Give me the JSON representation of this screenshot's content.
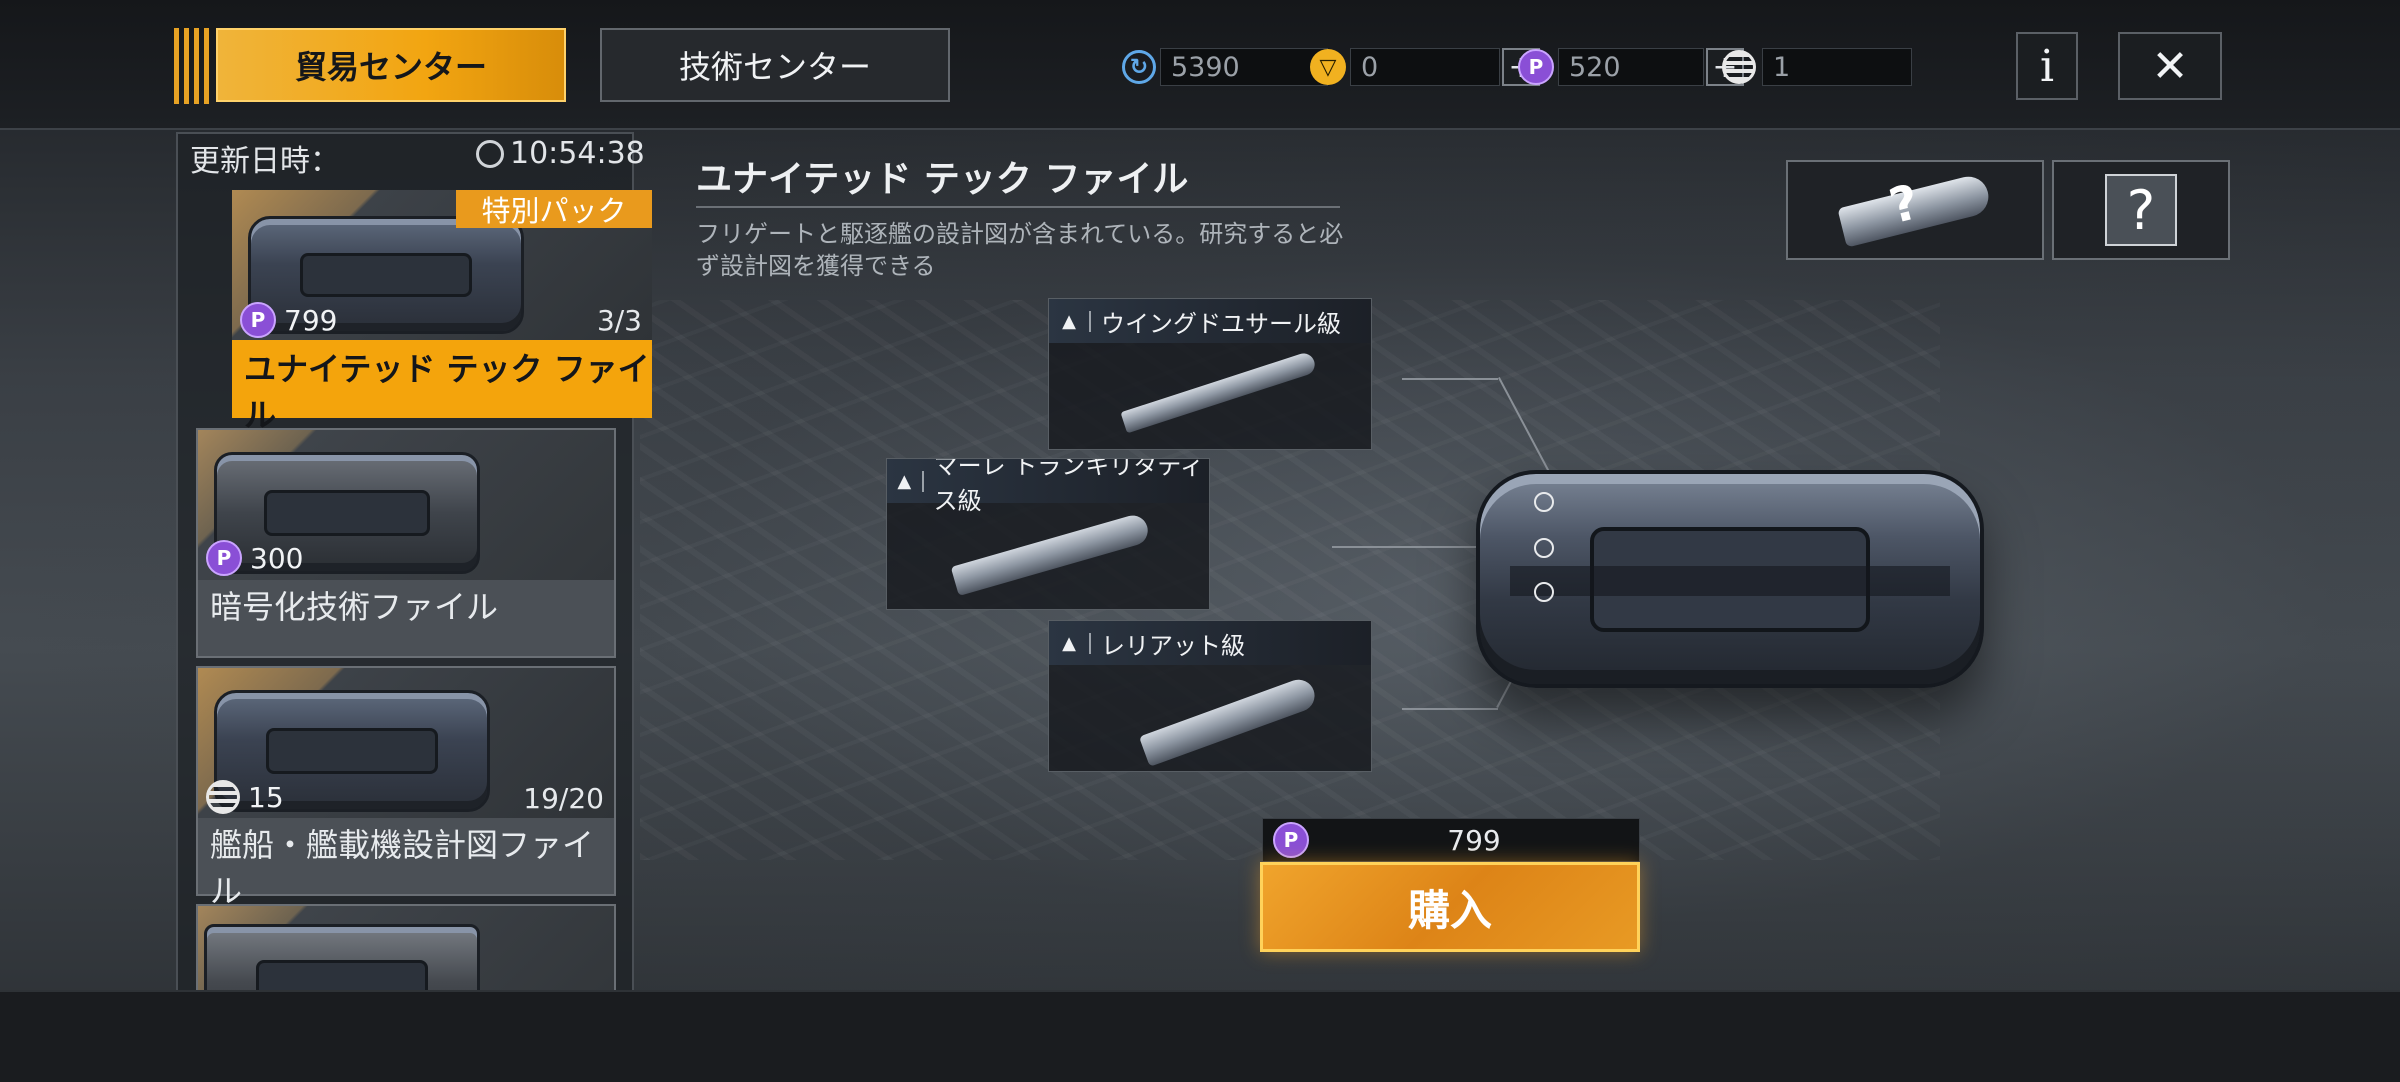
{
  "tabs": {
    "trade": "貿易センター",
    "tech": "技術センター"
  },
  "currencies": [
    {
      "icon": "refresh-coin-icon",
      "value": "5390"
    },
    {
      "icon": "gold-coin-icon",
      "value": "0"
    },
    {
      "icon": "purple-p-icon",
      "value": "520"
    },
    {
      "icon": "stripe-coin-icon",
      "value": "1"
    }
  ],
  "header_buttons": {
    "info": "i",
    "close": "✕"
  },
  "left_panel": {
    "update_label": "更新日時：",
    "update_time": "10:54:38",
    "items": [
      {
        "badge": "特別パック",
        "price": "799",
        "count": "3/3",
        "name": "ユナイテッド テック ファイル",
        "currency": "purple-p-icon"
      },
      {
        "price": "300",
        "count": "",
        "name": "暗号化技術ファイル",
        "currency": "purple-p-icon"
      },
      {
        "price": "15",
        "count": "19/20",
        "name": "艦船・艦載機設計図ファイル",
        "currency": "stripe-coin-icon"
      }
    ]
  },
  "main": {
    "title": "ユナイテッド テック ファイル",
    "description": "フリゲートと駆逐艦の設計図が含まれている。研究すると必ず設計図を獲得できる",
    "ships": [
      {
        "name": "ウイングドユサール級"
      },
      {
        "name": "マーレ トランキリタティス級"
      },
      {
        "name": "レリアット級"
      }
    ],
    "buy_price": "799",
    "buy_label": "購入"
  },
  "colors": {
    "accent": "#f2a511",
    "purple": "#8a4fd6"
  }
}
